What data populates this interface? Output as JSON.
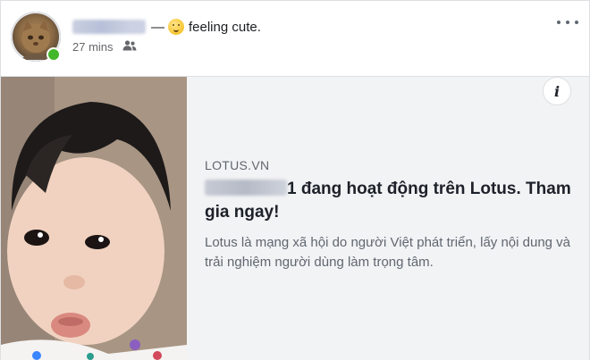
{
  "post": {
    "feeling_prefix": "—",
    "feeling_text": "feeling cute.",
    "timestamp": "27 mins",
    "audience_icon": "friends-icon",
    "more_icon": "more-options-icon"
  },
  "link_preview": {
    "domain": "LOTUS.VN",
    "title_rest": "1 đang hoạt động trên Lotus. Tham gia ngay!",
    "description": "Lotus là mạng xã hội do người Việt phát triển, lấy nội dung và trải nghiệm người dùng làm trọng tâm.",
    "info_label": "i"
  },
  "colors": {
    "online": "#42b72a",
    "preview_bg": "#f2f3f5",
    "meta_text": "#65676b"
  }
}
